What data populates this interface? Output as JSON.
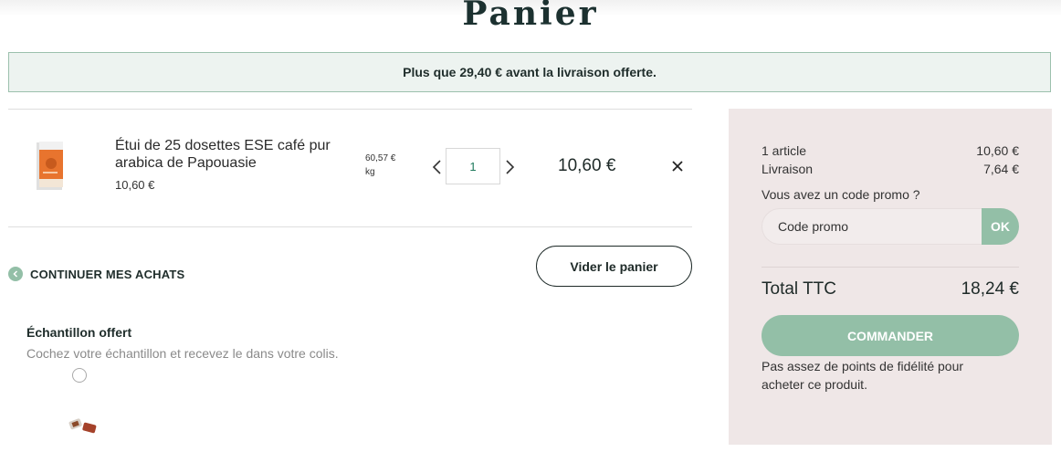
{
  "page": {
    "title": "Panier"
  },
  "banner": {
    "text": "Plus que 29,40 € avant la livraison offerte."
  },
  "cart": {
    "items": [
      {
        "name": "Étui de 25 dosettes ESE café pur arabica de Papouasie",
        "price": "10,60 €",
        "unit_price": "60,57 €",
        "unit": "kg",
        "quantity": "1",
        "line_total": "10,60 €"
      }
    ],
    "continue_label": "CONTINUER MES ACHATS",
    "empty_button": "Vider le panier"
  },
  "sample": {
    "title": "Échantillon offert",
    "description": "Cochez votre échantillon et recevez le dans votre colis."
  },
  "summary": {
    "articles_label": "1 article",
    "articles_value": "10,60 €",
    "shipping_label": "Livraison",
    "shipping_value": "7,64 €",
    "promo_question": "Vous avez un code promo ?",
    "promo_placeholder": "Code promo",
    "promo_button": "OK",
    "total_label": "Total TTC",
    "total_value": "18,24 €",
    "order_button": "COMMANDER",
    "loyalty_note": "Pas assez de points de fidélité pour acheter ce produit."
  },
  "colors": {
    "accent": "#93bfa7",
    "banner_bg": "#edf3f0",
    "summary_bg": "#efe7e7",
    "title": "#1c3130"
  },
  "icons": [
    "chevron-left-icon",
    "chevron-right-icon",
    "close-icon",
    "back-arrow-icon"
  ]
}
